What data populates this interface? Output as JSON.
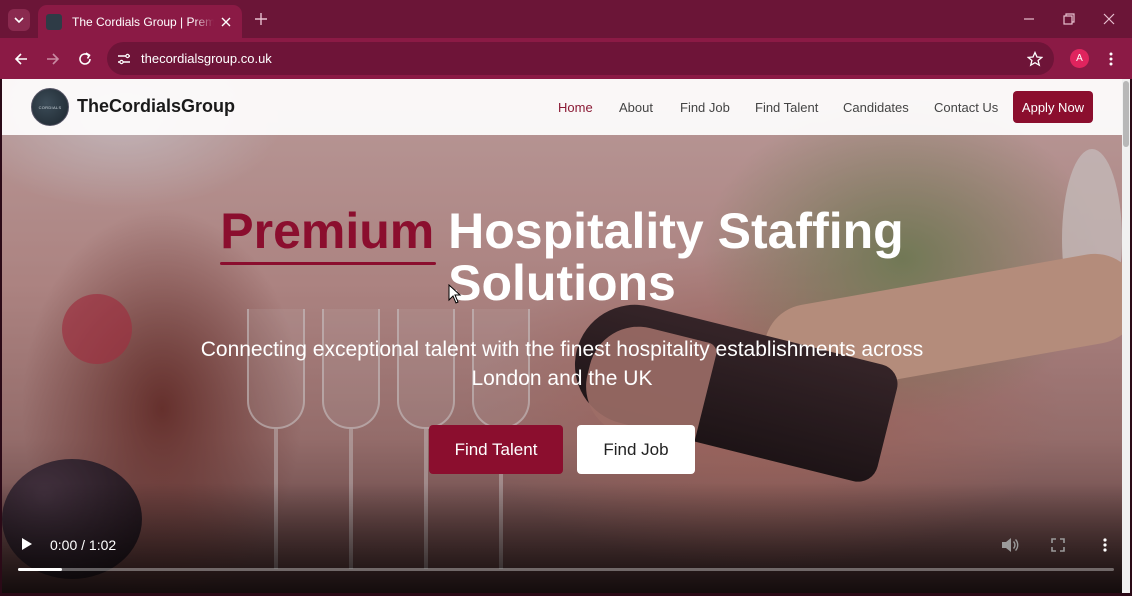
{
  "browser": {
    "tab": {
      "title": "The Cordials Group | Premium Hospitality",
      "favicon": "cordials-logo-favicon"
    },
    "address_bar": {
      "url": "thecordialsgroup.co.uk"
    },
    "profile_initial": "A",
    "colors": {
      "tabstrip": "#6b1537",
      "toolbar": "#8b1a45"
    }
  },
  "site": {
    "brand": "TheCordialsGroup",
    "logo_text": "CORDIALS",
    "nav": {
      "items": [
        {
          "label": "Home",
          "active": true
        },
        {
          "label": "About",
          "active": false
        },
        {
          "label": "Find Job",
          "active": false
        },
        {
          "label": "Find Talent",
          "active": false
        },
        {
          "label": "Candidates",
          "active": false
        },
        {
          "label": "Contact Us",
          "active": false
        }
      ],
      "cta": "Apply Now"
    },
    "hero": {
      "headline_accent": "Premium",
      "headline_rest_line1": "Hospitality Staffing",
      "headline_line2": "Solutions",
      "subtitle": "Connecting exceptional talent with the finest hospitality establishments across London and the UK",
      "primary_cta": "Find Talent",
      "secondary_cta": "Find Job"
    },
    "colors": {
      "accent": "#8b0e2e"
    }
  },
  "video": {
    "time": "0:00 / 1:02",
    "progress": 0.04
  }
}
